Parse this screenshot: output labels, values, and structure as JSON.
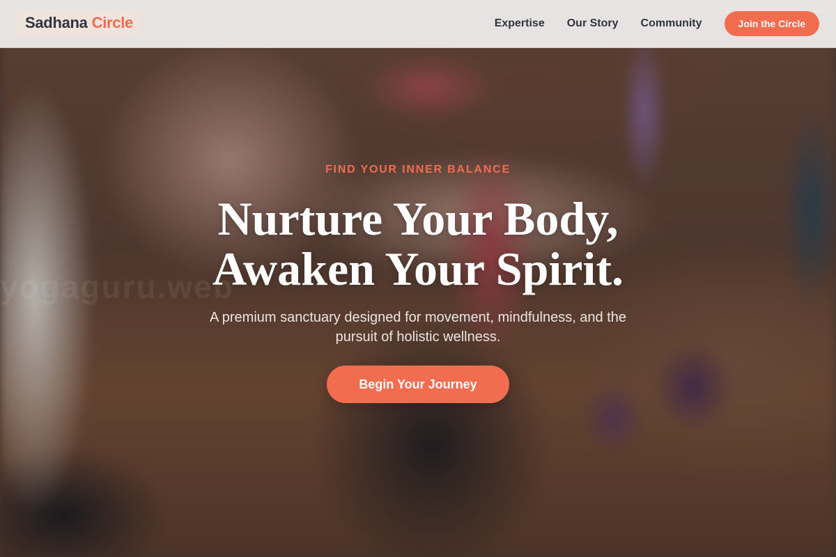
{
  "brand": {
    "name_primary": "Sadhana",
    "name_accent": "Circle"
  },
  "nav": {
    "links": [
      {
        "label": "Expertise"
      },
      {
        "label": "Our Story"
      },
      {
        "label": "Community"
      }
    ],
    "join_label": "Join the Circle"
  },
  "hero": {
    "eyebrow": "FIND YOUR INNER BALANCE",
    "title_line1": "Nurture Your Body,",
    "title_line2": "Awaken Your Spirit.",
    "subtitle": "A premium sanctuary designed for movement, mindfulness, and the pursuit of holistic wellness.",
    "cta_label": "Begin Your Journey",
    "watermark": "yogaguru.web"
  },
  "colors": {
    "accent": "#f26c4f",
    "text_dark": "#2e3440",
    "header_bg": "#ffffff"
  }
}
